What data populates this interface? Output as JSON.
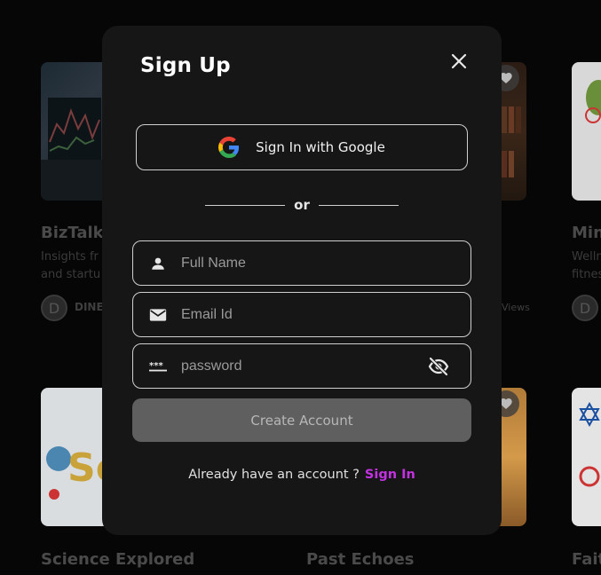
{
  "background": {
    "cards": [
      {
        "title": "BizTalk C",
        "desc_lines": [
          "Insights fr",
          "and startu"
        ],
        "avatar": "D",
        "author": "DINE"
      },
      {
        "title": "Mind",
        "desc_lines": [
          "Welln",
          "fitnes"
        ],
        "avatar": "D"
      },
      {
        "views": "Views"
      },
      {
        "title": "Science Explored"
      },
      {
        "title": "Past Echoes"
      },
      {
        "title": "Faith"
      }
    ]
  },
  "modal": {
    "title": "Sign Up",
    "google_label": "Sign In with Google",
    "divider_text": "or",
    "fields": {
      "full_name": {
        "placeholder": "Full Name",
        "value": ""
      },
      "email": {
        "placeholder": "Email Id",
        "value": ""
      },
      "password": {
        "placeholder": "password",
        "value": ""
      }
    },
    "create_label": "Create Account",
    "footer_prompt": "Already have an account ?",
    "footer_link": "Sign In"
  },
  "colors": {
    "accent_link": "#c232e0",
    "modal_bg": "#161616",
    "button_disabled": "#5f5f5f"
  },
  "icons": [
    "close-icon",
    "google-icon",
    "person-icon",
    "mail-icon",
    "password-icon",
    "eye-off-icon",
    "heart-icon"
  ]
}
